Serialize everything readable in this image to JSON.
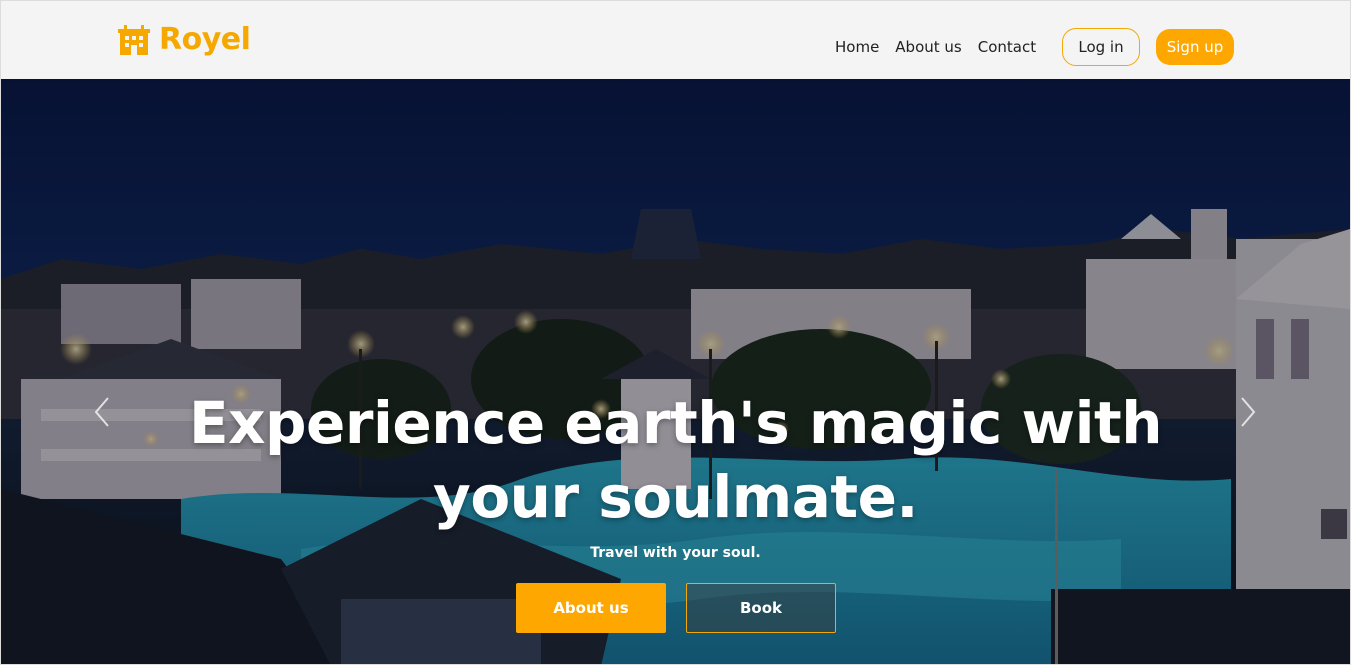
{
  "colors": {
    "accent": "#fea701",
    "accent_border": "#f5a800",
    "header_bg": "#f4f4f4",
    "nav_text": "#222222"
  },
  "header": {
    "brand": {
      "name": "Royel",
      "icon": "hotel-building-icon"
    },
    "nav": [
      {
        "label": "Home"
      },
      {
        "label": "About us"
      },
      {
        "label": "Contact"
      }
    ],
    "login_label": "Log in",
    "signup_label": "Sign up"
  },
  "hero": {
    "title": "Experience earth's magic with your soulmate.",
    "subtitle": "Travel with your soul.",
    "about_button": "About us",
    "book_button": "Book",
    "prev_icon": "chevron-left-icon",
    "next_icon": "chevron-right-icon"
  }
}
